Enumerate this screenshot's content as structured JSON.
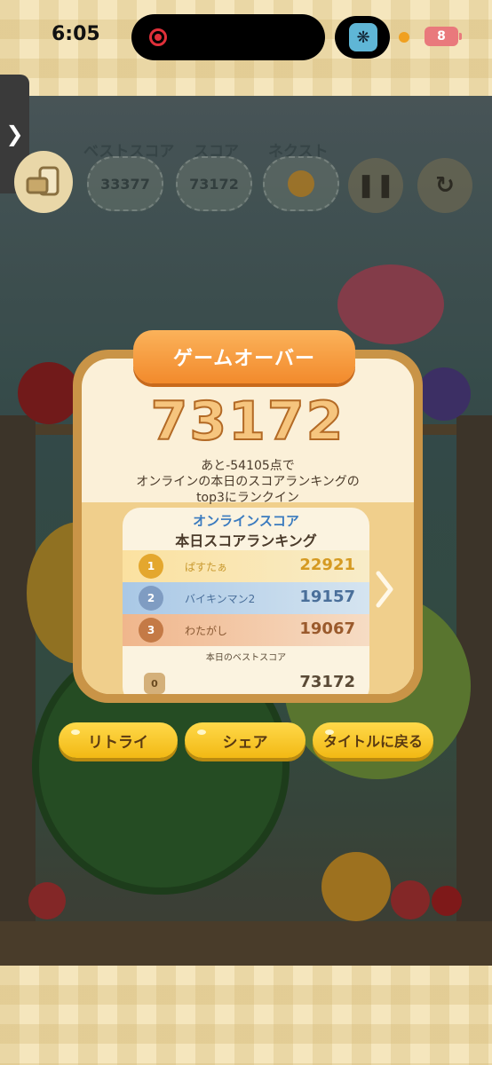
{
  "status_bar": {
    "time": "6:05",
    "battery": "8"
  },
  "side_tab": {
    "icon": "chevron-right-icon",
    "glyph": "❯"
  },
  "hud": {
    "best_label": "ベストスコア",
    "best_value": "33377",
    "score_label": "スコア",
    "score_value": "73172",
    "next_label": "ネクスト"
  },
  "game_over": {
    "title": "ゲームオーバー",
    "score": "73172",
    "remaining": "あと-54105点で",
    "msg_line1": "オンラインの本日のスコアランキングの",
    "msg_line2": "top3にランクイン"
  },
  "ranking": {
    "header1": "オンラインスコア",
    "header2": "本日スコアランキング",
    "rows": [
      {
        "rank": "1",
        "name": "ぱすたぁ",
        "score": "22921"
      },
      {
        "rank": "2",
        "name": "バイキンマン2",
        "score": "19157"
      },
      {
        "rank": "3",
        "name": "わたがし",
        "score": "19067"
      }
    ],
    "best_label": "本日のベストスコア",
    "best_rank": "0",
    "best_score": "73172"
  },
  "buttons": {
    "retry": "リトライ",
    "share": "シェア",
    "title": "タイトルに戻る"
  },
  "colors": {
    "accent_orange": "#f28a2c",
    "button_yellow": "#f2b914",
    "rank_blue": "#3b7bbf"
  }
}
